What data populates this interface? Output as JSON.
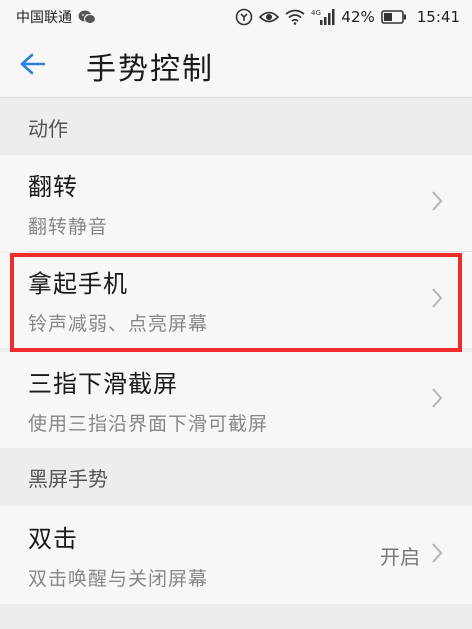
{
  "status_bar": {
    "carrier": "中国联通",
    "network": "4G",
    "battery": "42%",
    "time": "15:41",
    "icons": [
      "wechat-icon",
      "nfc-icon",
      "eye-icon",
      "wifi-icon",
      "signal-icon",
      "battery-icon"
    ]
  },
  "header": {
    "title": "手势控制",
    "back_icon": "arrow-left-icon"
  },
  "sections": [
    {
      "label": "动作",
      "items": [
        {
          "title": "翻转",
          "subtitle": "翻转静音"
        },
        {
          "title": "拿起手机",
          "subtitle": "铃声减弱、点亮屏幕"
        },
        {
          "title": "三指下滑截屏",
          "subtitle": "使用三指沿界面下滑可截屏"
        }
      ]
    },
    {
      "label": "黑屏手势",
      "items": [
        {
          "title": "双击",
          "subtitle": "双击唤醒与关闭屏幕",
          "value": "开启"
        }
      ]
    }
  ],
  "colors": {
    "accent": "#2d7fd8",
    "highlight": "#ee2c2c",
    "background": "#ededed",
    "card": "#f7f7f7"
  }
}
